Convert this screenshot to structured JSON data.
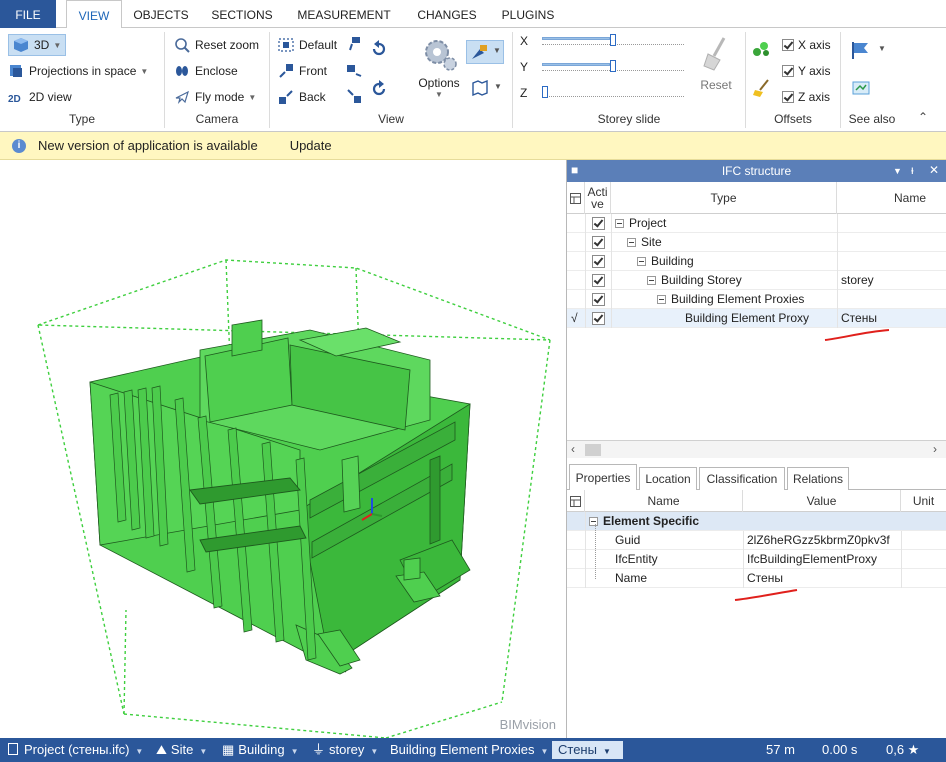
{
  "tabs": [
    "FILE",
    "VIEW",
    "OBJECTS",
    "SECTIONS",
    "MEASUREMENT",
    "CHANGES",
    "PLUGINS"
  ],
  "ribbon": {
    "type": {
      "btn_3d": "3D",
      "projections": "Projections in space",
      "view_2d": "2D view",
      "label": "Type"
    },
    "camera": {
      "reset_zoom": "Reset zoom",
      "enclose": "Enclose",
      "fly_mode": "Fly mode",
      "label": "Camera"
    },
    "view": {
      "default": "Default",
      "front": "Front",
      "back": "Back",
      "options": "Options",
      "label": "View"
    },
    "storey": {
      "x": "X",
      "y": "Y",
      "z": "Z",
      "reset": "Reset",
      "label": "Storey slide",
      "x_level": 0.5,
      "y_level": 0.5,
      "z_level": 0.0
    },
    "offsets": {
      "x_axis": "X axis",
      "y_axis": "Y axis",
      "z_axis": "Z axis",
      "label": "Offsets"
    },
    "see_also": {
      "label": "See also"
    }
  },
  "notification": {
    "message": "New version of application is available",
    "action": "Update"
  },
  "viewport": {
    "brand": "BIMvision"
  },
  "ifc_panel": {
    "title": "IFC structure",
    "columns": {
      "active": "Acti ve",
      "type": "Type",
      "name": "Name"
    },
    "rows": [
      {
        "type": "Project",
        "name": ""
      },
      {
        "type": "Site",
        "name": ""
      },
      {
        "type": "Building",
        "name": ""
      },
      {
        "type": "Building Storey",
        "name": "storey"
      },
      {
        "type": "Building Element Proxies",
        "name": ""
      },
      {
        "type": "Building Element Proxy",
        "name": "Стены",
        "marker": "√"
      }
    ]
  },
  "props_panel": {
    "tabs": [
      "Properties",
      "Location",
      "Classification",
      "Relations"
    ],
    "columns": {
      "name": "Name",
      "value": "Value",
      "unit": "Unit"
    },
    "group": "Element Specific",
    "rows": [
      {
        "name": "Guid",
        "value": "2lZ6heRGzz5kbrmZ0pkv3f"
      },
      {
        "name": "IfcEntity",
        "value": "IfcBuildingElementProxy"
      },
      {
        "name": "Name",
        "value": "Стены"
      }
    ]
  },
  "statusbar": {
    "crumbs": [
      "Project (стены.ifc)",
      "Site",
      "Building",
      "storey",
      "Building Element Proxies",
      "Стены"
    ],
    "distance": "57 m",
    "time": "0.00 s",
    "rating": "0,6 ★"
  },
  "colors": {
    "accent": "#2b579a",
    "model_green": "#4fcf4f",
    "selection": "#e8f1fb",
    "notification": "#fff7c0",
    "annotation_red": "#e0201c"
  }
}
